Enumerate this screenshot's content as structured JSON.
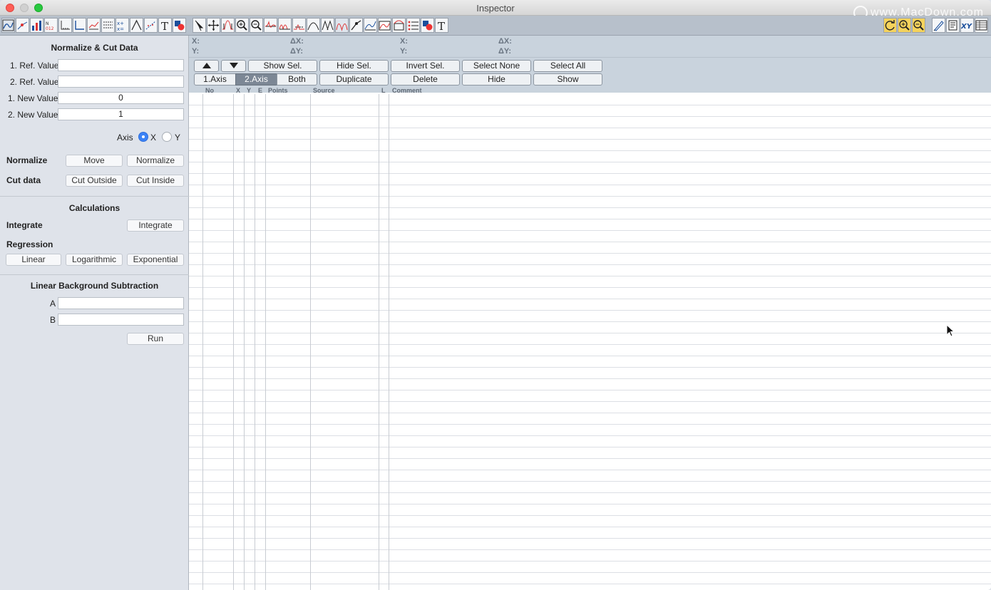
{
  "window": {
    "title": "Inspector",
    "watermark": "www.MacDown.com",
    "traffic_colors": {
      "close": "#fe5f57",
      "minimize": "#d0d0d0",
      "zoom": "#28c840"
    }
  },
  "sidebar": {
    "normalize_cut_title": "Normalize & Cut Data",
    "ref1_label": "1. Ref. Value",
    "ref1_value": "",
    "ref2_label": "2. Ref. Value",
    "ref2_value": "",
    "new1_label": "1. New Value",
    "new1_value": "0",
    "new2_label": "2. New Value",
    "new2_value": "1",
    "axis_label": "Axis",
    "axis_x": "X",
    "axis_y": "Y",
    "axis_selected": "X",
    "normalize_label": "Normalize",
    "move_button": "Move",
    "normalize_button": "Normalize",
    "cut_label": "Cut data",
    "cut_outside_button": "Cut Outside",
    "cut_inside_button": "Cut Inside",
    "calculations_title": "Calculations",
    "integrate_label": "Integrate",
    "integrate_button": "Integrate",
    "regression_label": "Regression",
    "linear_button": "Linear",
    "logarithmic_button": "Logarithmic",
    "exponential_button": "Exponential",
    "lbs_title": "Linear Background Subtraction",
    "a_label": "A",
    "a_value": "",
    "b_label": "B",
    "b_value": "",
    "run_button": "Run"
  },
  "info": {
    "x": "X:",
    "y": "Y:",
    "dx": "ΔX:",
    "dy": "ΔY:",
    "x2": "X:",
    "y2": "Y:",
    "dx2": "ΔX:",
    "dy2": "ΔY:"
  },
  "buttons": {
    "show_sel": "Show Sel.",
    "hide_sel": "Hide Sel.",
    "invert_sel": "Invert Sel.",
    "select_none": "Select None",
    "select_all": "Select All",
    "axis1": "1.Axis",
    "axis2": "2.Axis",
    "both": "Both",
    "duplicate": "Duplicate",
    "delete": "Delete",
    "hide": "Hide",
    "show": "Show",
    "selected_axis": "2.Axis"
  },
  "table": {
    "columns": [
      "No",
      "X",
      "Y",
      "E",
      "Points",
      "Source",
      "L",
      "Comment"
    ]
  },
  "toolbar_icons": {
    "left": [
      "graph-overview-icon",
      "scatter-line-icon",
      "bar-chart-icon",
      "number-format-icon",
      "axis-ticks-icon",
      "axis-frame-icon",
      "line-style-icon",
      "legend-list-icon",
      "data-table-icon",
      "peak-style-icon",
      "dashed-fit-icon",
      "text-T-icon",
      "color-shapes-icon"
    ],
    "middle": [
      "pointer-icon",
      "move-cross-icon",
      "peak-select-icon",
      "zoom-in-icon",
      "zoom-out-icon",
      "wave-peak-icon",
      "double-peak-icon",
      "baseline-icon",
      "peak-fit-icon",
      "gaussian-icon",
      "multi-peak-icon",
      "point-link-icon",
      "curve-icon",
      "window-curve-icon",
      "shape-curve-icon",
      "dotted-list-icon",
      "color-shapes-icon",
      "text-T-icon"
    ],
    "right": [
      "refresh-icon",
      "zoom-in-icon",
      "zoom-out-icon",
      "pen-icon",
      "notes-icon",
      "xy-icon",
      "table-grid-icon"
    ]
  }
}
